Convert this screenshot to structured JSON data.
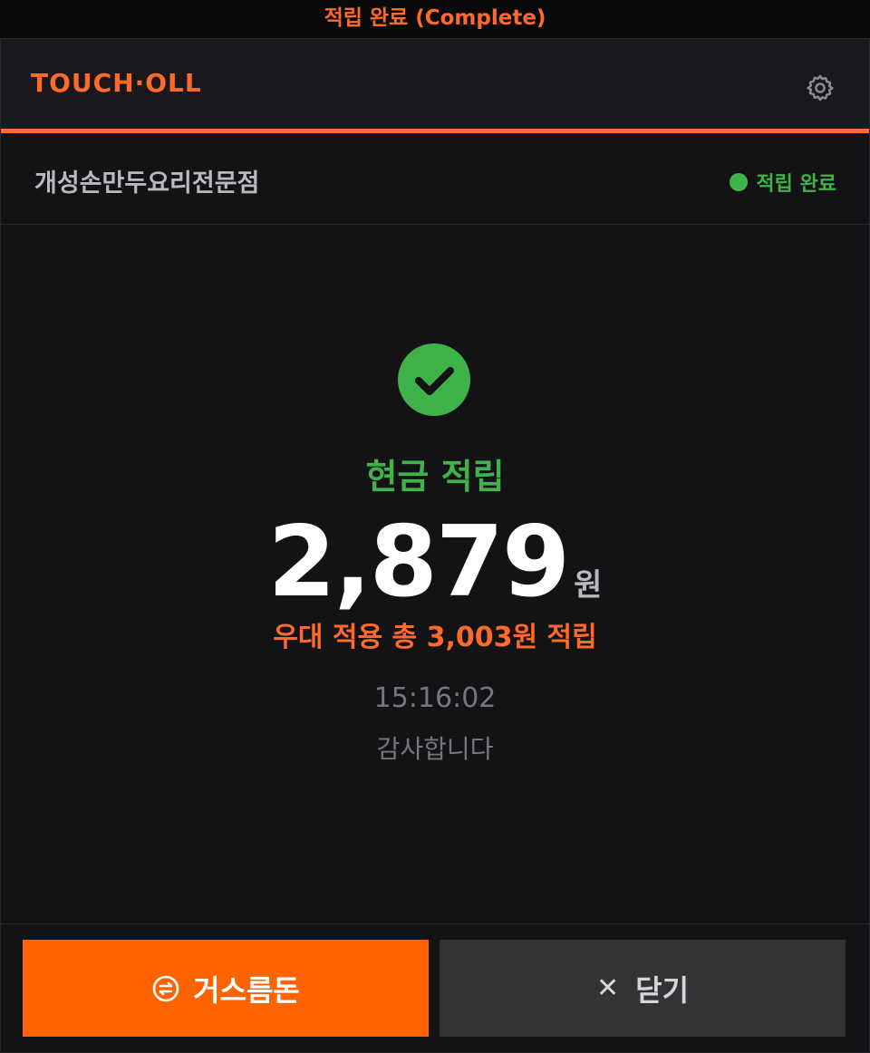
{
  "window": {
    "title": "적립 완료 (Complete)"
  },
  "header": {
    "brand": "TOUCH·OLL",
    "settings_icon": "gear-icon"
  },
  "store": {
    "name": "개성손만두요리전문점",
    "status": "적립 완료",
    "status_color": "#3fb24a"
  },
  "result": {
    "icon": "check-circle-icon",
    "reward_type": "현금 적립",
    "amount": "2,879",
    "unit": "원",
    "bonus_text": "우대 적용 총 3,003원 적립",
    "time": "15:16:02",
    "thanks": "감사합니다"
  },
  "footer": {
    "change_button": {
      "label": "거스름돈",
      "icon": "exchange-icon",
      "color": "#ff6400"
    },
    "close_button": {
      "label": "닫기",
      "icon_glyph": "✕"
    }
  },
  "colors": {
    "accent": "#ff6a2c",
    "success": "#3fb24a",
    "background": "#131316"
  }
}
